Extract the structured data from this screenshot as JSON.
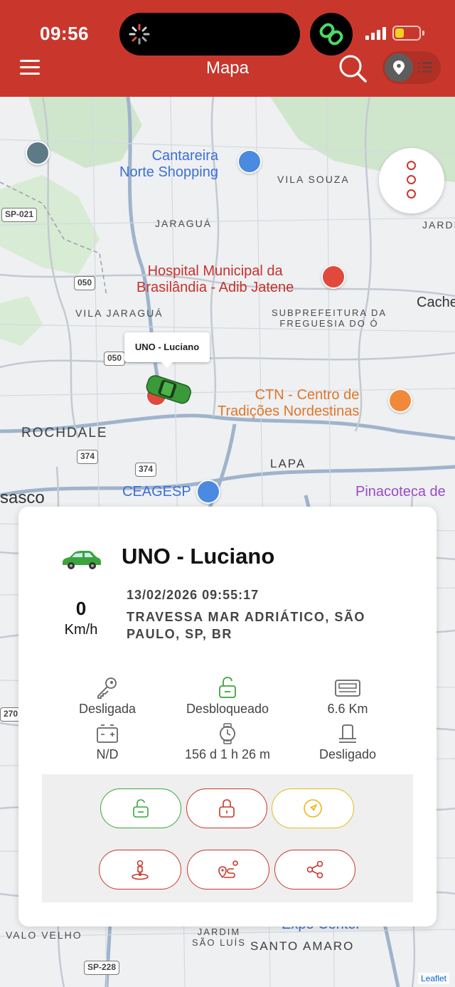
{
  "status_bar": {
    "time": "09:56"
  },
  "header": {
    "title": "Mapa"
  },
  "map": {
    "labels": {
      "cantareira": "Cantareira\nNorte Shopping",
      "vila_souza": "VILA SOUZA",
      "jaragua": "JARAGUÁ",
      "jardi": "JARDI",
      "hospital": "Hospital Municipal da\nBrasilândia - Adib Jatene",
      "cache": "Cache",
      "vila_jaragua": "VILA JARAGUÁ",
      "subprefeitura": "SUBPREFEITURA DA\nFREGUESIA DO Ó",
      "ctn": "CTN - Centro de\nTradições Nordestinas",
      "rochdale": "ROCHDALE",
      "lapa": "LAPA",
      "ceagesp": "CEAGESP",
      "pinacoteca": "Pinacoteca de",
      "osasco": "sasco",
      "valo_velho": "VALO VELHO",
      "jardim_sao_luis": "JARDIM\nSÃO LUÍS",
      "santo_amaro": "SANTO AMARO",
      "expo_center": "Expo Center"
    },
    "shields": [
      "SP-021",
      "050",
      "050",
      "374",
      "374",
      "SP-228",
      "270"
    ],
    "tooltip": "UNO - Luciano",
    "attribution": "Leaflet"
  },
  "vehicle": {
    "name": "UNO - Luciano",
    "speed": "0",
    "speed_unit": "Km/h",
    "timestamp": "13/02/2026 09:55:17",
    "address": "TRAVESSA MAR ADRIÁTICO, SÃO PAULO, SP, BR",
    "stats": [
      {
        "icon": "key-icon",
        "label": "Desligada"
      },
      {
        "icon": "unlock-icon",
        "label": "Desbloqueado"
      },
      {
        "icon": "odometer-icon",
        "label": "6.6 Km"
      },
      {
        "icon": "battery-icon",
        "label": "N/D"
      },
      {
        "icon": "watch-icon",
        "label": "156 d 1 h 26 m"
      },
      {
        "icon": "ignition-icon",
        "label": "Desligado"
      }
    ]
  },
  "colors": {
    "brand": "#c9372c",
    "green": "#3aa53a",
    "yellow": "#e8b81a"
  }
}
